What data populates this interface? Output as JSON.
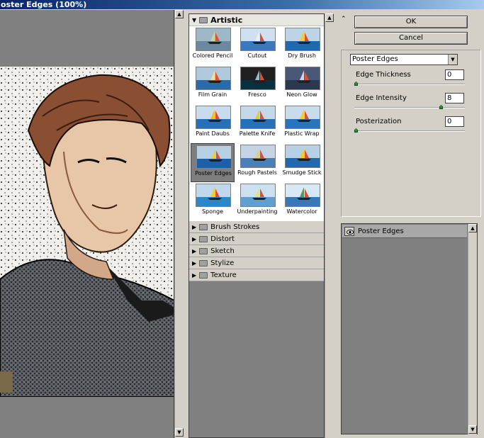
{
  "window": {
    "title": "oster Edges (100%)"
  },
  "categories": {
    "open": {
      "name": "Artistic"
    },
    "filters": [
      {
        "label": "Colored Pencil",
        "style": "pencil"
      },
      {
        "label": "Cutout",
        "style": "cutout"
      },
      {
        "label": "Dry Brush",
        "style": "dry"
      },
      {
        "label": "Film Grain",
        "style": "grain"
      },
      {
        "label": "Fresco",
        "style": "fresco"
      },
      {
        "label": "Neon Glow",
        "style": "neon"
      },
      {
        "label": "Paint Daubs",
        "style": "daubs"
      },
      {
        "label": "Palette Knife",
        "style": "knife"
      },
      {
        "label": "Plastic Wrap",
        "style": "plastic"
      },
      {
        "label": "Poster Edges",
        "style": "poster",
        "selected": true
      },
      {
        "label": "Rough Pastels",
        "style": "rough"
      },
      {
        "label": "Smudge Stick",
        "style": "smudge"
      },
      {
        "label": "Sponge",
        "style": "sponge"
      },
      {
        "label": "Underpainting",
        "style": "under"
      },
      {
        "label": "Watercolor",
        "style": "water"
      }
    ],
    "closed": [
      "Brush Strokes",
      "Distort",
      "Sketch",
      "Stylize",
      "Texture"
    ]
  },
  "buttons": {
    "ok": "OK",
    "cancel": "Cancel"
  },
  "filter_select": {
    "value": "Poster Edges"
  },
  "params": [
    {
      "label": "Edge Thickness",
      "value": "0",
      "level": 0,
      "range": [
        0,
        10
      ]
    },
    {
      "label": "Edge Intensity",
      "value": "8",
      "level": 8,
      "range": [
        0,
        10
      ]
    },
    {
      "label": "Posterization",
      "value": "0",
      "level": 0,
      "range": [
        0,
        6
      ]
    }
  ],
  "layers": {
    "items": [
      {
        "name": "Poster Edges"
      }
    ]
  },
  "icons": {
    "collapse": "double-chevron-up-icon",
    "eye": "eye-icon",
    "folder": "folder-icon"
  }
}
